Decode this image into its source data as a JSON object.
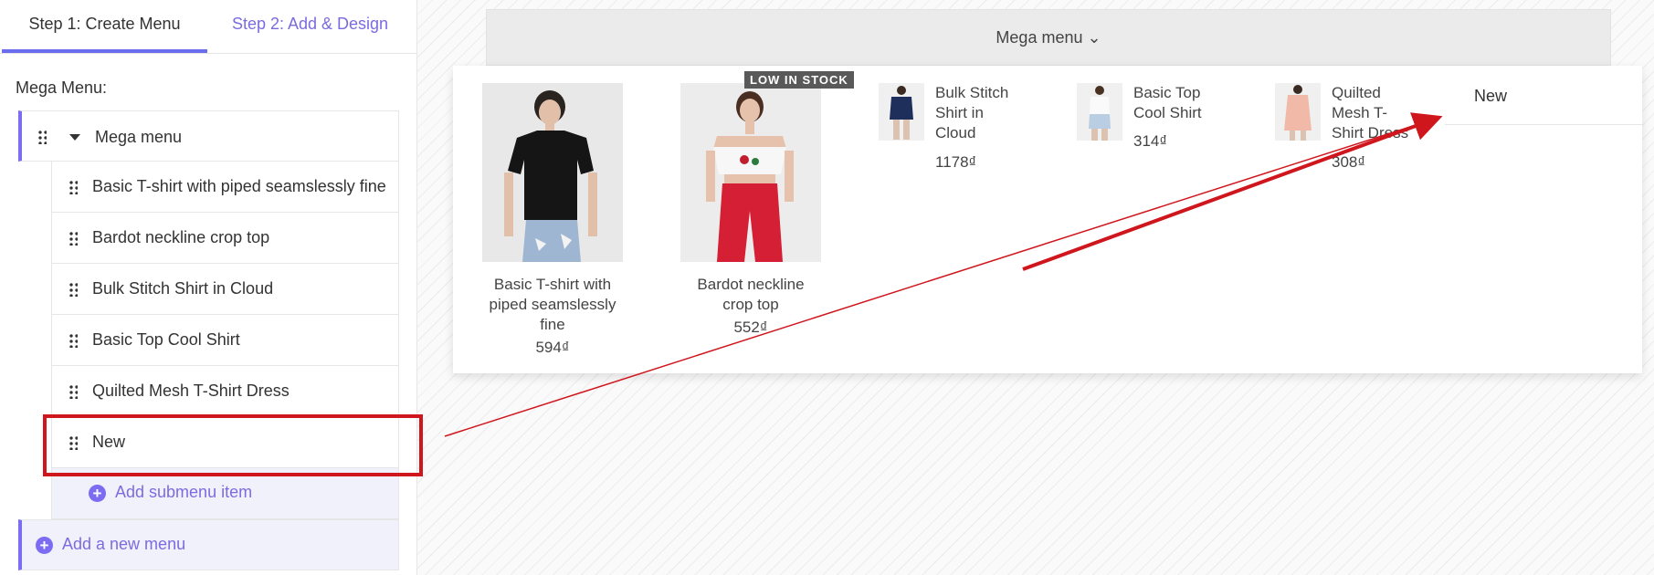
{
  "tabs": [
    "Step 1: Create Menu",
    "Step 2: Add & Design"
  ],
  "sidebar": {
    "section_label": "Mega Menu:",
    "root_item": "Mega menu",
    "sub_items": [
      "Basic T-shirt with piped seamslessly fine",
      "Bardot neckline crop top",
      "Bulk Stitch Shirt in Cloud",
      "Basic Top Cool Shirt",
      "Quilted Mesh T-Shirt Dress",
      "New"
    ],
    "add_submenu_label": "Add submenu item",
    "add_menu_label": "Add a new menu"
  },
  "preview": {
    "menubar_label": "Mega menu ⌄",
    "products_large": [
      {
        "title": "Basic T-shirt with piped seamslessly fine",
        "price": "594₫"
      },
      {
        "title": "Bardot neckline crop top",
        "price": "552₫",
        "badge": "LOW IN STOCK"
      }
    ],
    "products_small": [
      {
        "title": "Bulk Stitch Shirt in Cloud",
        "price": "1178₫"
      },
      {
        "title": "Basic Top Cool Shirt",
        "price": "314₫"
      },
      {
        "title": "Quilted Mesh T-Shirt Dress",
        "price": "308₫"
      }
    ],
    "new_link": "New"
  },
  "colors": {
    "accent": "#7c6cf2",
    "annotation_red": "#d0161d"
  }
}
